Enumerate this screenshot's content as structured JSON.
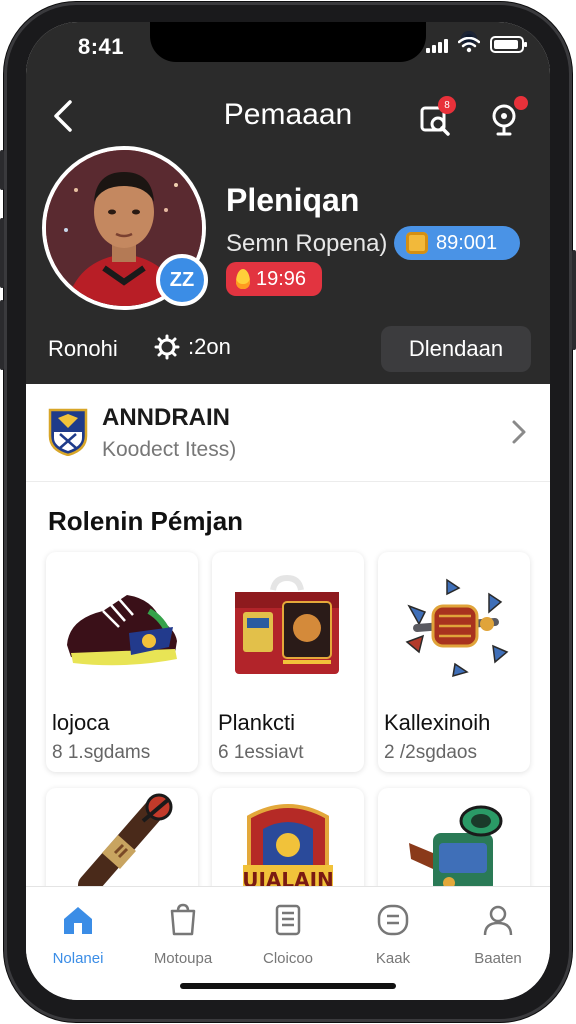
{
  "status_bar": {
    "time": "8:41"
  },
  "nav": {
    "title": "Pemaaan",
    "back_icon": "chevron-left-icon",
    "notification_badge": "8"
  },
  "profile": {
    "name": "Pleniqan",
    "subtitle": "Semn Ropena)",
    "coins": "89:001",
    "streak": "19:96",
    "badge": "ZZ",
    "stat_left": "Ronohi",
    "stat_mid": ":2on",
    "follow_label": "Dlendaan"
  },
  "team": {
    "name": "ANNDRAIN",
    "subtitle": "Koodect Itess)"
  },
  "section": {
    "title": "Rolenin Pémjan"
  },
  "items": [
    {
      "name": "lojoca",
      "count": "8 1.sgdams",
      "icon": "football-boot-icon"
    },
    {
      "name": "Plankcti",
      "count": "6 1essiavt",
      "icon": "gift-box-icon"
    },
    {
      "name": "Kallexinoih",
      "count": "2 /2sgdaos",
      "icon": "gear-cannon-icon"
    },
    {
      "name": "",
      "count": "",
      "icon": "torch-icon"
    },
    {
      "name": "",
      "count": "",
      "icon": "crest-badge-icon"
    },
    {
      "name": "",
      "count": "",
      "icon": "watering-can-icon"
    }
  ],
  "crest_text": "UIALAIN",
  "tabs": [
    {
      "label": "Nolanei",
      "icon": "home-icon",
      "active": true
    },
    {
      "label": "Motoupa",
      "icon": "bag-icon",
      "active": false
    },
    {
      "label": "Cloicoo",
      "icon": "document-icon",
      "active": false
    },
    {
      "label": "Kaak",
      "icon": "list-circle-icon",
      "active": false
    },
    {
      "label": "Baaten",
      "icon": "person-icon",
      "active": false
    }
  ],
  "colors": {
    "accent": "#3b8de6",
    "header_bg": "#2b2b2b",
    "alert": "#e23440",
    "coin": "#f2b93a"
  }
}
